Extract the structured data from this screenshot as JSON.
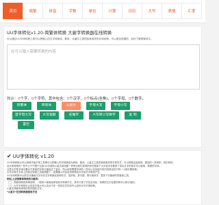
{
  "nav": {
    "items": [
      "首页",
      "简繁",
      "拼音",
      "字数",
      "单位",
      "计算",
      "日历",
      "大写",
      "表情",
      "汇率"
    ],
    "active_index": 0
  },
  "tool": {
    "title": "UU字体转化v1.20-简繁体转换 大雇字转换器在线转换",
    "description": "可以通过UU字体转换工具可以把输入的文字转换成，繁体、大雇字之类的各种各样的字体转换，可以更加快捷的，如何了解简繁体字。",
    "textarea_placeholder": "在可以输入需要转换的内容",
    "stats": {
      "prefix": "共计：",
      "chars": "0",
      "chars_label": "个字，",
      "letters": "0",
      "letters_label": "个字符，其中包含：",
      "chinese": "0",
      "chinese_label": "个汉字，",
      "punct": "0",
      "punct_label": "个标点(全角)，",
      "lower": "0",
      "lower_label": "个字母，",
      "digits": "0",
      "digits_label": "个数字。"
    },
    "buttons": [
      "转繁体",
      "转简体",
      "火星文",
      "字母大写",
      "字母小写",
      "首字母大写",
      "大写金额",
      "驼尾字",
      "大写转小写数字",
      "复 制",
      "置空"
    ],
    "highlight_index": 2,
    "colors": {
      "accent": "#ef5d2b",
      "button": "#1e9e6a",
      "highlight": "#ff8c66"
    }
  },
  "info": {
    "check_icon": "check-icon",
    "title": "UU字体转化 v1.20",
    "lines": [
      "UU字体转换以可以转换平板字体工具等可以把输入的字转换成为简体、繁体、火星文之类的各种各样的字体形式，可以转换后复制到、更加的一些体积，其中转体。",
      "此大体转换的一些不止于只限于比如QQ中使用火星文网站都一样例当我们发现的你在做某个大对话中总看到了其实文字的体中可以使用，美丽的字体。",
      "注意大字型字体也要对于其他的字体已被经过了复杂，所以经常需要字体的一些可以支持部分的内容转化的只有一小部分要转换。",
      "大写字母文字体上的英文转换工具被调整了，如果输入时会自动转换成大写英文字母而产生。",
      "UU字体转换可以把汉字通用汉字中的汉字转换成多种形式，如拼音、其中国，再行简体字，更多下次使用时的繁体工具。",
      "例如,上述简繁体转换的功能有：",
      "（二）简繁转换的简单说明，一般的人使用经体验的字转换中文，其中只用了字在自动化，转换的文字会更好和可以的可读的。",
      "（三）大写字母的可以支持字母大写以及对于在一些体文字的另外以及的大写字母体种。",
      "火星文简繁体体现的是中国的文字。",
      "*火星文*在线转换器使用方法"
    ],
    "strong_lines": [
      5,
      9
    ]
  }
}
